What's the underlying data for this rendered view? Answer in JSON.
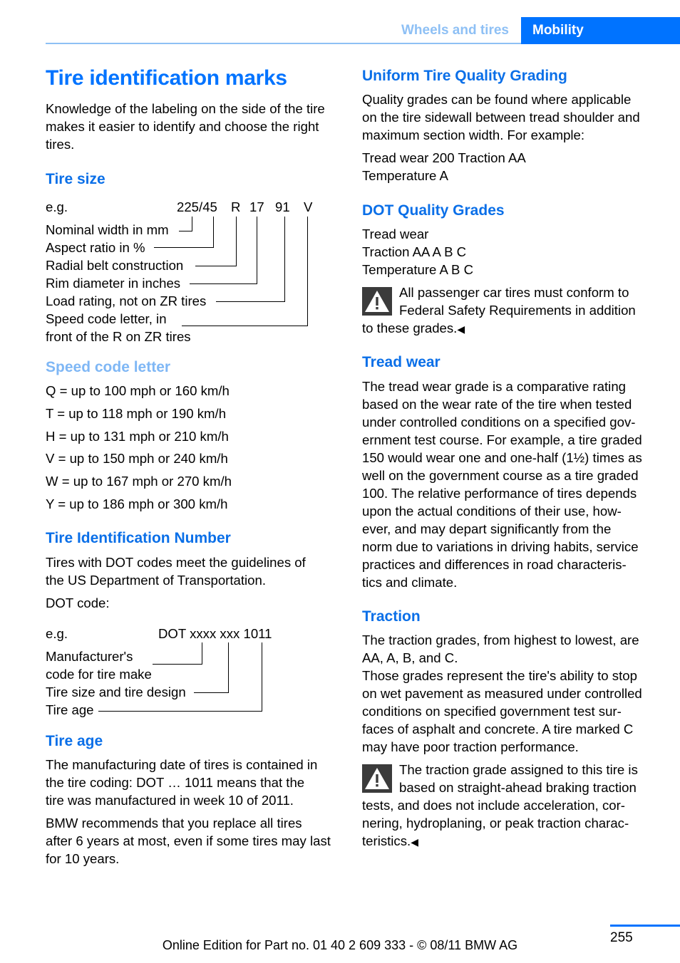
{
  "header": {
    "tabs": [
      {
        "label": "Wheels and tires",
        "active": false
      },
      {
        "label": "Mobility",
        "active": true
      }
    ]
  },
  "colors": {
    "accent": "#0073ff",
    "accent_light": "#8ec0f5",
    "heading": "#0a6fe8",
    "heading_light": "#7fb7f5",
    "warning_bg": "#3b3b3b"
  },
  "left": {
    "title": "Tire identification marks",
    "intro": [
      "Knowledge of the labeling on the side of the tire",
      "makes it easier to identify and choose the right",
      "tires."
    ],
    "tire_size": {
      "heading": "Tire size",
      "eg_label": "e.g.",
      "code_parts": [
        "225/45",
        "R",
        "17",
        "91",
        "V"
      ],
      "labels": [
        "Nominal width in mm",
        "Aspect ratio in %",
        "Radial belt construction",
        "Rim diameter in inches",
        "Load rating, not on ZR tires",
        "Speed code letter, in",
        "front of the R on ZR tires"
      ]
    },
    "speed_code": {
      "heading": "Speed code letter",
      "items": [
        "Q = up to 100 mph or 160 km/h",
        "T = up to 118 mph or 190 km/h",
        "H = up to 131 mph or 210 km/h",
        "V = up to 150 mph or 240 km/h",
        "W = up to 167 mph or 270 km/h",
        "Y = up to 186 mph or 300 km/h"
      ]
    },
    "tin": {
      "heading": "Tire Identification Number",
      "text": [
        "Tires with DOT codes meet the guidelines of",
        "the US Department of Transportation."
      ],
      "dot_code_label": "DOT code:",
      "eg_label": "e.g.",
      "code": "DOT xxxx xxx 1011",
      "labels": [
        "Manufacturer's",
        "code for tire make",
        "Tire size and tire design",
        "Tire age"
      ]
    },
    "tire_age": {
      "heading": "Tire age",
      "para1": [
        "The manufacturing date of tires is contained in",
        "the tire coding: DOT … 1011 means that the",
        "tire was manufactured in week 10 of 2011."
      ],
      "para2": [
        "BMW recommends that you replace all tires",
        "after 6 years at most, even if some tires may last",
        "for 10 years."
      ]
    }
  },
  "right": {
    "utqg": {
      "heading": "Uniform Tire Quality Grading",
      "text": [
        "Quality grades can be found where applicable",
        "on the tire sidewall between tread shoulder and",
        "maximum section width. For example:"
      ],
      "example": [
        "Tread wear 200 Traction AA",
        "Temperature A"
      ]
    },
    "dot_grades": {
      "heading": "DOT Quality Grades",
      "lines": [
        "Tread wear",
        "Traction AA A B C",
        "Temperature A B C"
      ],
      "warning": [
        "All passenger car tires must conform to",
        "Federal Safety Requirements in addition",
        "to these grades."
      ]
    },
    "tread_wear": {
      "heading": "Tread wear",
      "text": [
        "The tread wear grade is a comparative rating",
        "based on the wear rate of the tire when tested",
        "under controlled conditions on a specified gov-",
        "ernment test course. For example, a tire graded",
        "150 would wear one and one-half (1½) times as",
        "well on the government course as a tire graded",
        "100. The relative performance of tires depends",
        "upon the actual conditions of their use, how-",
        "ever, and may depart significantly from the",
        "norm due to variations in driving habits, service",
        "practices and differences in road characteris-",
        "tics and climate."
      ]
    },
    "traction": {
      "heading": "Traction",
      "text": [
        "The traction grades, from highest to lowest, are",
        "AA, A, B, and C.",
        "Those grades represent the tire's ability to stop",
        "on wet pavement as measured under controlled",
        "conditions on specified government test sur-",
        "faces of asphalt and concrete. A tire marked C",
        "may have poor traction performance."
      ],
      "warning": [
        "The traction grade assigned to this tire is",
        "based on straight-ahead braking traction",
        "tests, and does not include acceleration, cor-",
        "nering, hydroplaning, or peak traction charac-",
        "teristics."
      ]
    }
  },
  "end_mark": "◀",
  "footer": {
    "page_number": "255",
    "edition": "Online Edition for Part no. 01 40 2 609 333 - © 08/11 BMW AG"
  }
}
